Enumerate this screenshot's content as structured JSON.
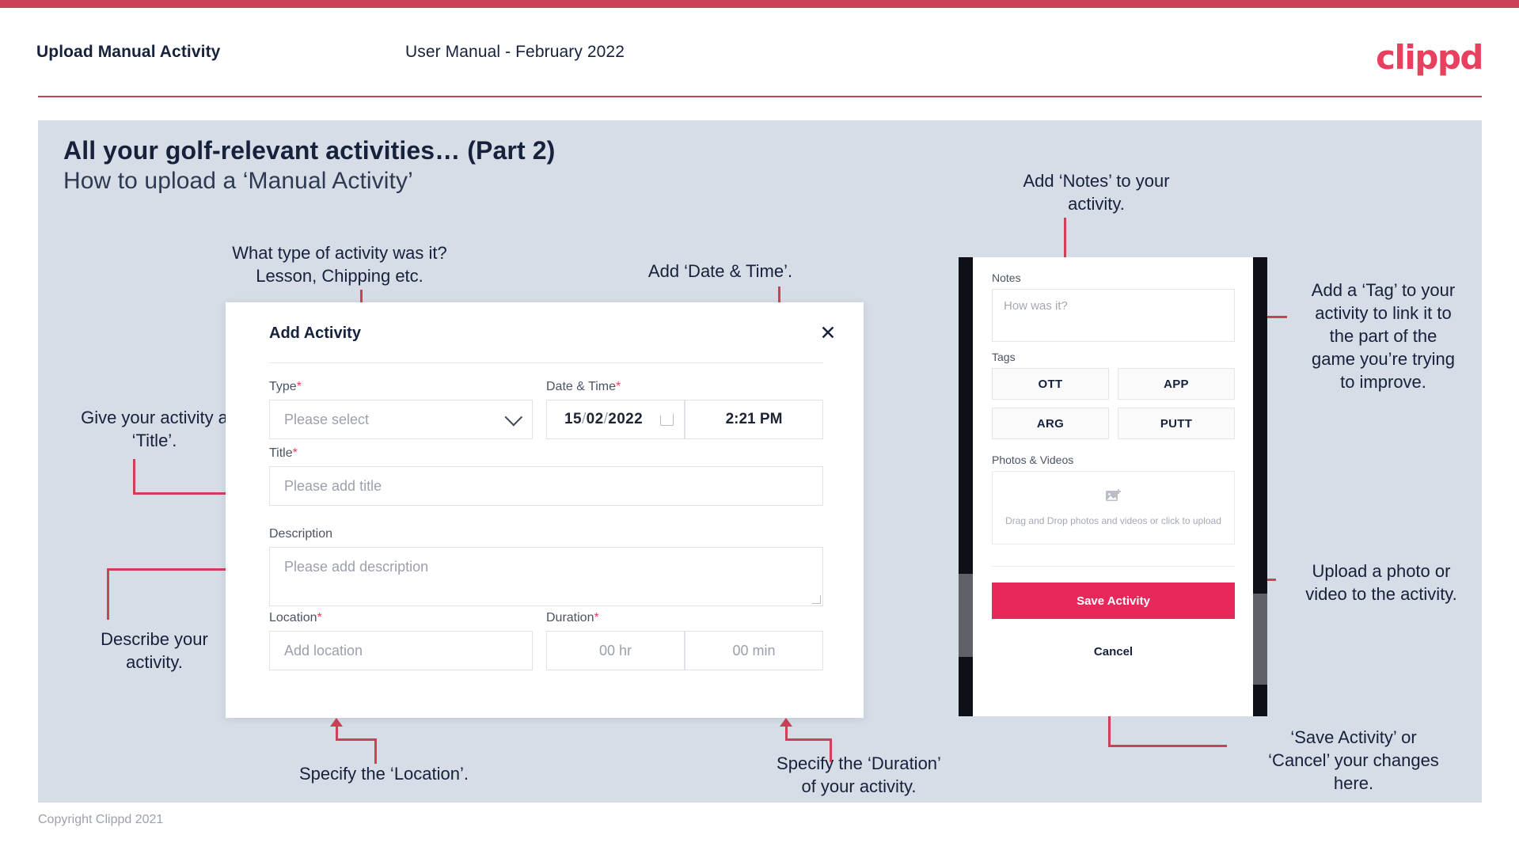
{
  "header": {
    "title": "Upload Manual Activity",
    "subtitle": "User Manual - February 2022",
    "brand": "clippd",
    "accent_color": "#cc4158",
    "brand_color": "#e8415f"
  },
  "slide": {
    "title": "All your golf-relevant activities… (Part 2)",
    "subtitle": "How to upload a ‘Manual Activity’",
    "background_color": "#d6dde6"
  },
  "annotations": {
    "type": "What type of activity was it?\nLesson, Chipping etc.",
    "date_time": "Add ‘Date & Time’.",
    "title": "Give your activity a\n‘Title’.",
    "description": "Describe your\nactivity.",
    "location": "Specify the ‘Location’.",
    "duration": "Specify the ‘Duration’\nof your activity.",
    "notes": "Add ‘Notes’ to your\nactivity.",
    "tags": "Add a ‘Tag’ to your\nactivity to link it to\nthe part of the\ngame you’re trying\nto improve.",
    "upload": "Upload a photo or\nvideo to the activity.",
    "save_cancel": "‘Save Activity’ or\n‘Cancel’ your changes\nhere."
  },
  "dialog": {
    "title": "Add Activity",
    "close_icon": "close-icon",
    "fields": {
      "type": {
        "label": "Type",
        "required": "*",
        "placeholder": "Please select",
        "value": "",
        "chevron_icon": "chevron-down-icon"
      },
      "date_time": {
        "label": "Date & Time",
        "required": "*",
        "day": "15",
        "month": "02",
        "year": "2022",
        "separator": "/",
        "calendar_icon": "calendar-icon",
        "time": "2:21 PM"
      },
      "title": {
        "label": "Title",
        "required": "*",
        "placeholder": "Please add title",
        "value": ""
      },
      "description": {
        "label": "Description",
        "required": "",
        "placeholder": "Please add description",
        "value": ""
      },
      "location": {
        "label": "Location",
        "required": "*",
        "placeholder": "Add location",
        "value": ""
      },
      "duration": {
        "label": "Duration",
        "required": "*",
        "hours_placeholder": "00 hr",
        "minutes_placeholder": "00 min"
      }
    }
  },
  "phone": {
    "notes": {
      "label": "Notes",
      "placeholder": "How was it?",
      "value": ""
    },
    "tags": {
      "label": "Tags",
      "options": [
        "OTT",
        "APP",
        "ARG",
        "PUTT"
      ]
    },
    "photos": {
      "label": "Photos & Videos",
      "dropzone_text": "Drag and Drop photos and videos or\nclick to upload",
      "icon": "add-image-icon"
    },
    "save_label": "Save Activity",
    "cancel_label": "Cancel",
    "save_color": "#e8285a"
  },
  "footer": {
    "copyright": "Copyright Clippd 2021"
  }
}
